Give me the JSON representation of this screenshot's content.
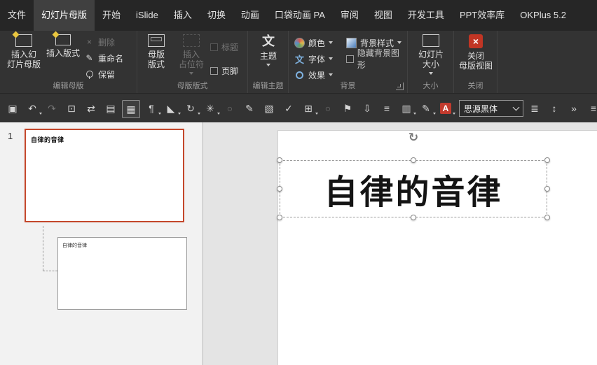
{
  "colors": {
    "tab_bar_bg": "#262626",
    "ribbon_bg": "#333333",
    "selection_border": "#c4472b",
    "close_red": "#c13524",
    "font_color_red": "#c23b2e",
    "icon_blue": "#7fb2e0"
  },
  "menu": {
    "tabs": [
      {
        "label": "文件"
      },
      {
        "label": "幻灯片母版",
        "active": true
      },
      {
        "label": "开始"
      },
      {
        "label": "iSlide"
      },
      {
        "label": "插入"
      },
      {
        "label": "切换"
      },
      {
        "label": "动画"
      },
      {
        "label": "口袋动画 PA"
      },
      {
        "label": "审阅"
      },
      {
        "label": "视图"
      },
      {
        "label": "开发工具"
      },
      {
        "label": "PPT效率库"
      },
      {
        "label": "OKPlus 5.2"
      }
    ]
  },
  "ribbon": {
    "groups": [
      {
        "label": "编辑母版"
      },
      {
        "label": "母版版式"
      },
      {
        "label": "编辑主题"
      },
      {
        "label": "背景"
      },
      {
        "label": "大小"
      },
      {
        "label": "关闭"
      }
    ],
    "buttons": {
      "insert_slide_master": "插入幻\n灯片母版",
      "insert_layout": "插入版式",
      "delete": "删除",
      "rename": "重命名",
      "preserve": "保留",
      "master_layout": "母版\n版式",
      "insert_placeholder": "插入\n占位符",
      "title_checkbox": "标题",
      "footer_checkbox": "页脚",
      "themes": "主题",
      "colors": "颜色",
      "fonts": "字体",
      "effects": "效果",
      "background_styles": "背景样式",
      "hide_background": "隐藏背景图形",
      "slide_size": "幻灯片\n大小",
      "close_master": "关闭\n母版视图"
    },
    "icons": {
      "theme_glyph": "文",
      "font_glyph": "文",
      "rename_glyph": "✎",
      "delete_glyph": "×",
      "close_glyph": "×"
    }
  },
  "toolbar": {
    "font_selector": {
      "value": "思源黑体"
    },
    "icons": [
      {
        "name": "save",
        "glyph": "▣"
      },
      {
        "name": "undo",
        "glyph": "↶"
      },
      {
        "name": "redo",
        "glyph": "↷"
      },
      {
        "name": "slideshow",
        "glyph": "⊡"
      },
      {
        "name": "find-replace",
        "glyph": "⇄"
      },
      {
        "name": "selection-pane",
        "glyph": "▤"
      },
      {
        "name": "grid",
        "glyph": "▦"
      },
      {
        "name": "paragraph",
        "glyph": "¶"
      },
      {
        "name": "shape-fill",
        "glyph": "◣"
      },
      {
        "name": "rotate",
        "glyph": "↻"
      },
      {
        "name": "effects",
        "glyph": "✳"
      },
      {
        "name": "oval",
        "glyph": "○"
      },
      {
        "name": "brush",
        "glyph": "✎"
      },
      {
        "name": "notebook",
        "glyph": "▧"
      },
      {
        "name": "checkmark",
        "glyph": "✓"
      },
      {
        "name": "copy",
        "glyph": "⊞"
      },
      {
        "name": "circle",
        "glyph": "○"
      },
      {
        "name": "flag",
        "glyph": "⚑"
      },
      {
        "name": "move-down",
        "glyph": "⇩"
      },
      {
        "name": "align-left",
        "glyph": "≡"
      },
      {
        "name": "table",
        "glyph": "▥"
      },
      {
        "name": "pencil",
        "glyph": "✎"
      },
      {
        "name": "font-color",
        "glyph": "A"
      },
      {
        "name": "bullet-list",
        "glyph": "≣"
      },
      {
        "name": "line-spacing",
        "glyph": "↕"
      },
      {
        "name": "indent",
        "glyph": "»"
      },
      {
        "name": "align-justify",
        "glyph": "≡"
      }
    ]
  },
  "slides_panel": {
    "slide_number": "1",
    "master_thumb_text": "自律的音律",
    "layout_thumb_text": "自律的音律"
  },
  "canvas": {
    "title_text": "自律的音律",
    "rotate_glyph": "↻"
  }
}
